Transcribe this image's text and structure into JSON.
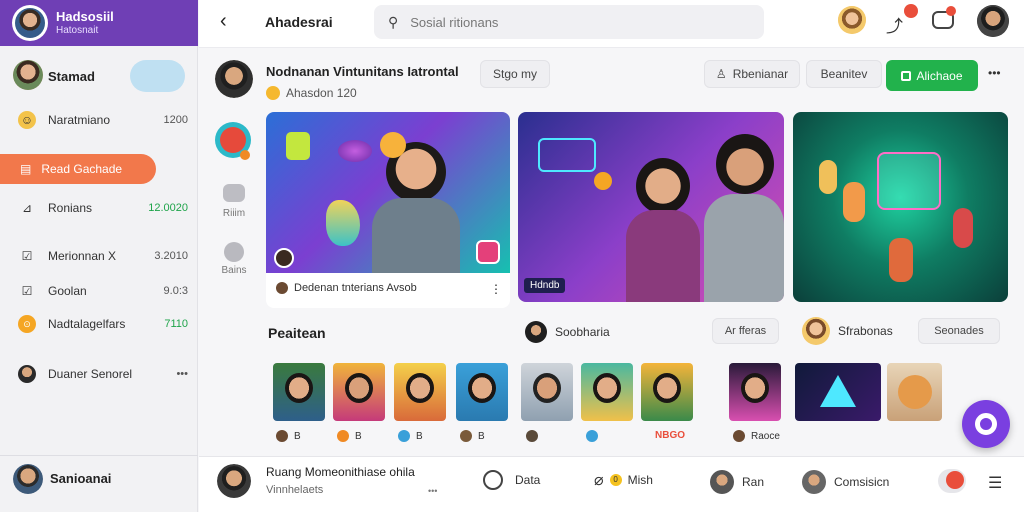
{
  "sidebar": {
    "brand_name": "Hadsosiil",
    "brand_sub": "Hatosnait",
    "profile_name": "Stamad",
    "items": [
      {
        "label": "Naratmiano",
        "value": "1200",
        "icon": "user-icon"
      },
      {
        "label": "Read Gachade",
        "value": "",
        "icon": "note-icon",
        "active": true
      },
      {
        "label": "Ronians",
        "value": "12.0020",
        "icon": "chart-icon"
      },
      {
        "label": "Merionnan X",
        "value": "3.2010",
        "icon": "check-icon"
      },
      {
        "label": "Goolan",
        "value": "9.0:3",
        "icon": "checkbox-icon"
      },
      {
        "label": "Nadtalagelfars",
        "value": "7110",
        "icon": "coin-icon"
      },
      {
        "label": "Duaner Senorel",
        "value": "",
        "icon": "avatar-icon"
      }
    ],
    "footer_name": "Sanioanai",
    "more_glyph": "•••"
  },
  "topbar": {
    "back_glyph": "‹",
    "title": "Ahadesrai",
    "search_placeholder": "Sosial ritionans",
    "notif_count": "",
    "msg_count": ""
  },
  "profile": {
    "name": "Nodnanan Vintunitans Iatrontal",
    "sub": "Ahasdon 120",
    "follow_chip": "Stgo my",
    "btn_remind": "Rbenianar",
    "btn_review": "Beanitev",
    "btn_primary": "Alichaoe",
    "more_glyph": "•••"
  },
  "rail": {
    "item1": "Riiim",
    "item2": "Bains"
  },
  "cards": {
    "card1_caption": "Dedenan tnterians Avsob",
    "card1_more": "⋮",
    "card2_tag": "Hdndb",
    "section_left_title": "Peaitean",
    "section_mid_name": "Soobharia",
    "section_mid_chip": "Ar fferas",
    "section_right_name": "Sfrabonas",
    "section_right_chip": "Seonades",
    "captions": [
      "B",
      "B",
      "B",
      "B",
      "",
      "",
      "NBGO",
      "Raoce"
    ]
  },
  "bottombar": {
    "title": "Ruang Momeonithiase ohila",
    "sub": "Vinnhelaets",
    "more_glyph": "•••",
    "item1": "Data",
    "item2": "Mish",
    "item3": "Ran",
    "item4": "Comsisicn",
    "item2_value": "0"
  },
  "colors": {
    "brand": "#6f3fb5",
    "accent_orange": "#f2784b",
    "primary_green": "#22b24c",
    "value_green": "#1fa44a",
    "fab": "#7a3fe0"
  }
}
